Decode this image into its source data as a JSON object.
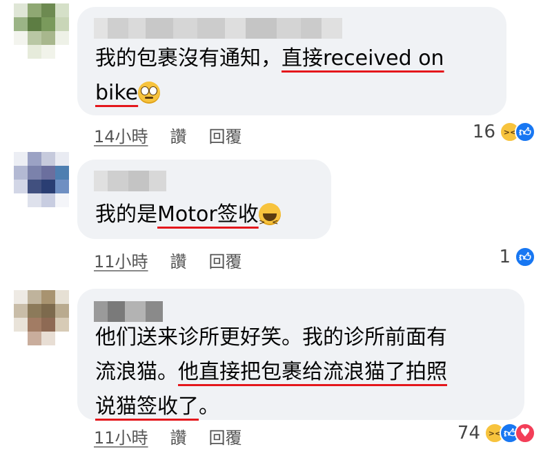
{
  "comments": [
    {
      "text_lines": [
        {
          "plain": "我的包裹沒有通知，",
          "underlined": "直接received on"
        },
        {
          "plain": "",
          "underlined": "bike"
        }
      ],
      "time": "14小時",
      "like_label": "讚",
      "reply_label": "回覆",
      "reaction_count": "16",
      "reactions": [
        "haha",
        "like"
      ]
    },
    {
      "text_lines": [
        {
          "plain": "我的是",
          "underlined": "Motor签收"
        }
      ],
      "time": "11小時",
      "like_label": "讚",
      "reply_label": "回覆",
      "reaction_count": "1",
      "reactions": [
        "like"
      ]
    },
    {
      "text_lines": [
        {
          "plain": "他们送来诊所更好笑。我的诊所前面有",
          "underlined": ""
        },
        {
          "plain": "流浪猫。",
          "underlined": "他直接把包裹给流浪猫了拍照"
        },
        {
          "plain": "",
          "underlined": "说猫签收了",
          "tail": "。"
        }
      ],
      "time": "11小時",
      "like_label": "讚",
      "reply_label": "回覆",
      "reaction_count": "74",
      "reactions": [
        "haha",
        "like",
        "love"
      ]
    }
  ],
  "colors": {
    "bubble": "#f0f2f5",
    "underline": "#e4161b",
    "like": "#1877f2",
    "love": "#f33e58",
    "haha": "#f7c33d"
  },
  "icons": {
    "eye_roll_emoji": "face-with-rolling-eyes-icon",
    "laughing_emoji": "grinning-squinting-face-icon",
    "like_reaction": "thumbs-up-icon",
    "haha_reaction": "haha-icon",
    "love_reaction": "heart-icon"
  }
}
